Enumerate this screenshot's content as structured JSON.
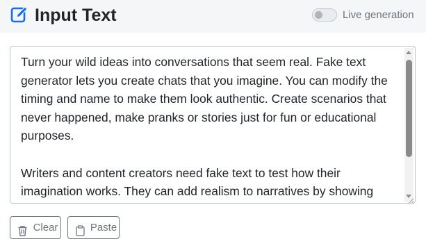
{
  "header": {
    "title": "Input Text",
    "title_icon": "edit-icon",
    "live_generation": {
      "label": "Live generation",
      "enabled": false
    }
  },
  "editor": {
    "text": "Turn your wild ideas into conversations that seem real. Fake text generator lets you create chats that you imagine. You can modify the timing and name to make them look authentic. Create scenarios that never happened, make pranks or stories just for fun or educational purposes.\n\nWriters and content creators need fake text to test how their imagination works. They can add realism to narratives by showing"
  },
  "actions": {
    "clear_label": "Clear",
    "clear_icon": "trash-icon",
    "paste_label": "Paste",
    "paste_icon": "clipboard-icon"
  },
  "colors": {
    "accent": "#0d6efd",
    "header_bg": "#f5f6f8",
    "secondary": "#6c757d"
  }
}
